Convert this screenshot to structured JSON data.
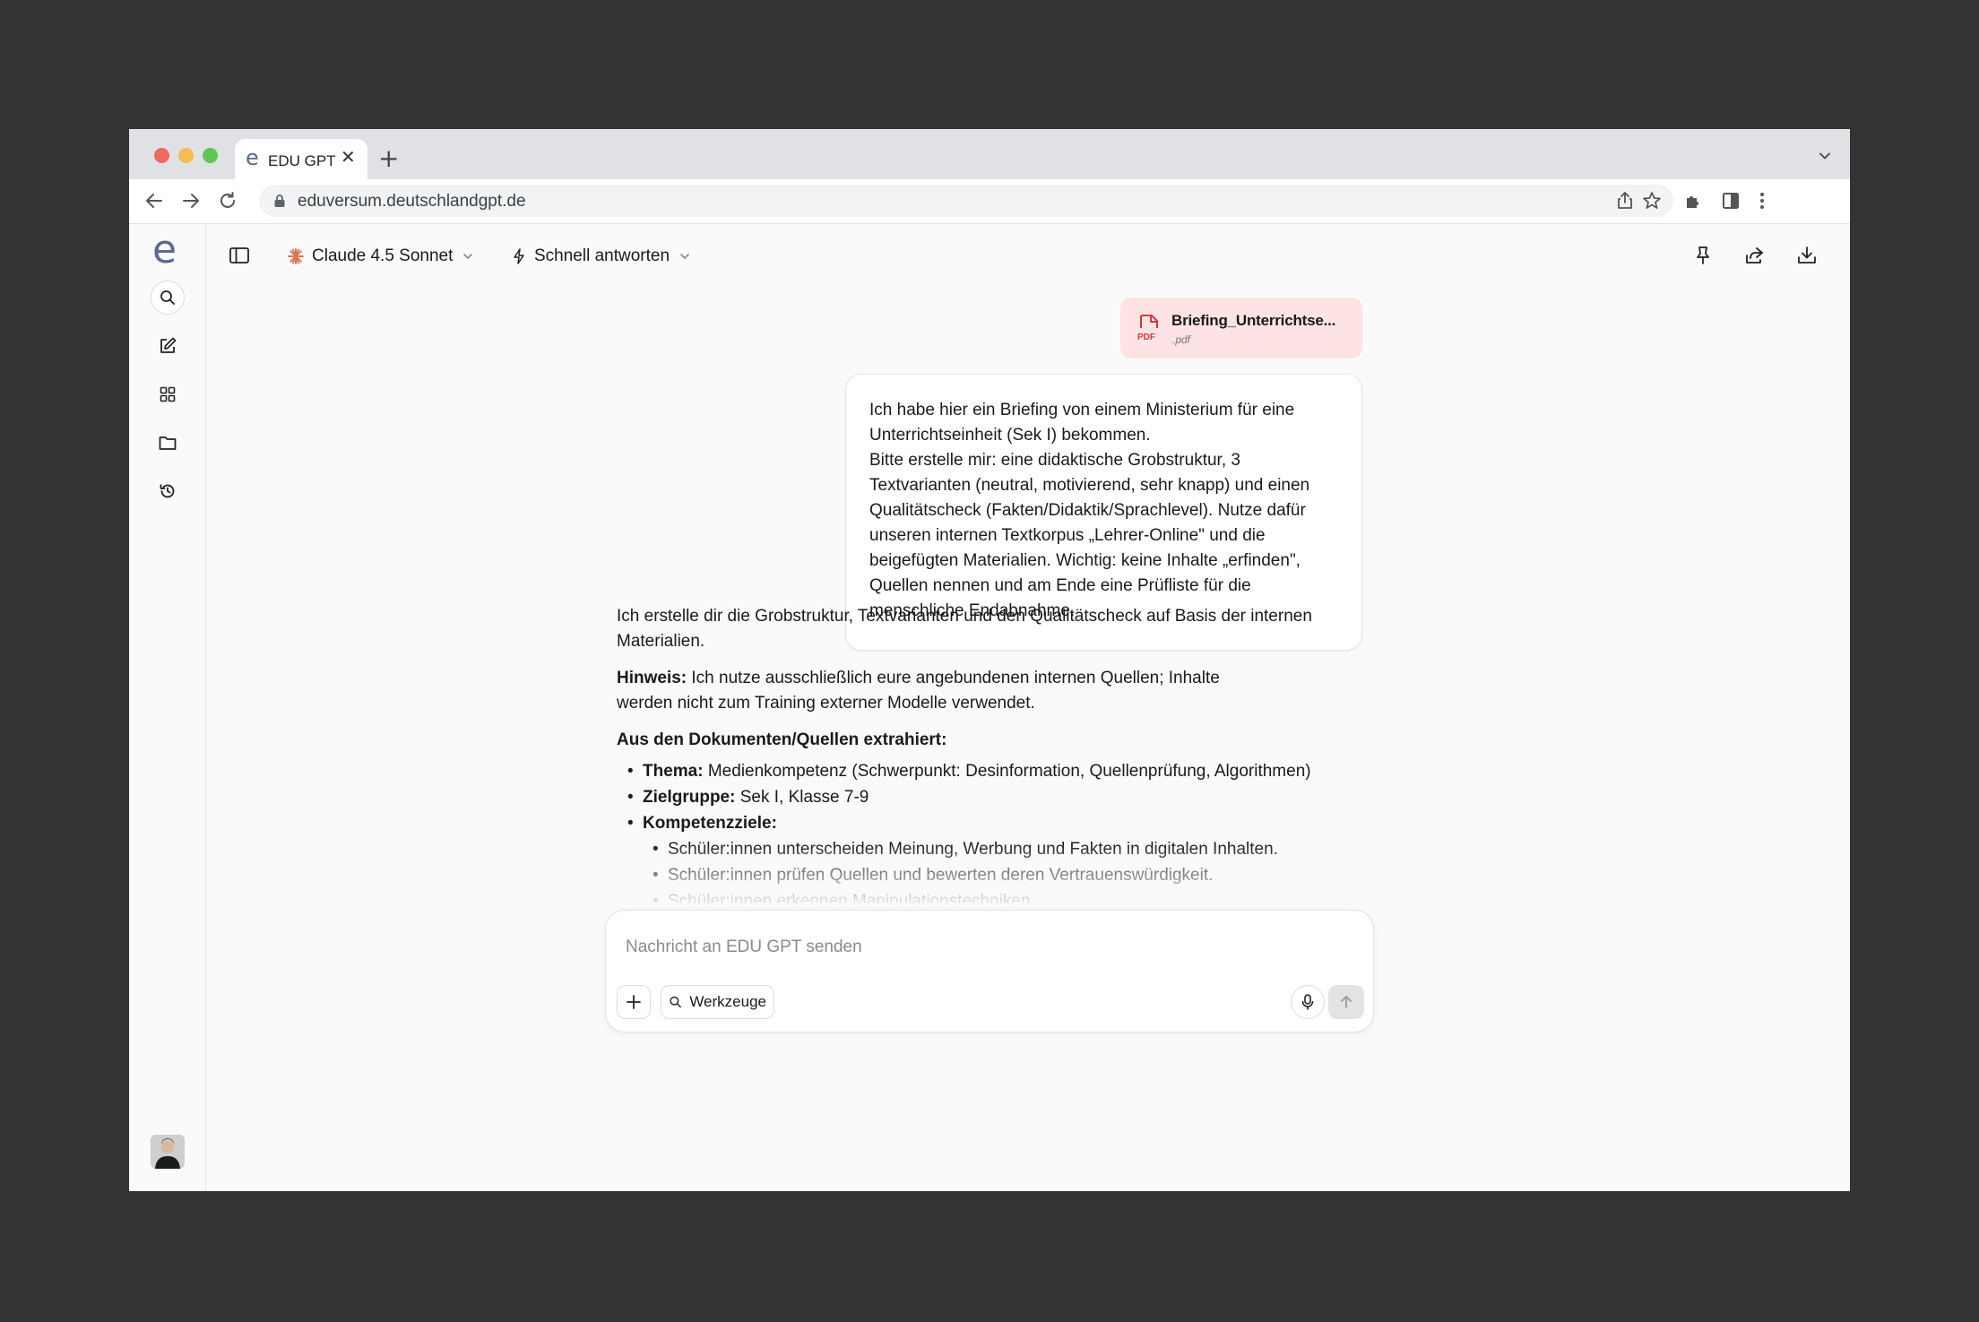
{
  "browser": {
    "tab_title": "EDU GPT",
    "tab_favicon": "e",
    "url": "eduversum.deutschlandgpt.de"
  },
  "sidebar": {
    "brand": "e",
    "items": [
      {
        "icon": "search-icon"
      },
      {
        "icon": "new-chat-icon"
      },
      {
        "icon": "apps-grid-icon"
      },
      {
        "icon": "folder-icon"
      },
      {
        "icon": "history-icon"
      }
    ]
  },
  "topbar": {
    "model": "Claude 4.5 Sonnet",
    "mode": "Schnell antworten"
  },
  "attachment": {
    "badge": "PDF",
    "name": "Briefing_Unterrichtse...",
    "ext": ".pdf"
  },
  "user_message": [
    "Ich habe hier ein Briefing von einem Ministerium für eine Unterrichtseinheit (Sek I) bekommen.",
    "Bitte erstelle mir: eine didaktische Grobstruktur, 3 Textvarianten (neutral, motivierend, sehr knapp) und einen Qualitätscheck (Fakten/Didaktik/Sprachlevel). Nutze dafür unseren internen Textkorpus „Lehrer-Online\" und die beigefügten Materialien. Wichtig: keine Inhalte „erfinden\", Quellen nennen und am Ende eine Prüfliste für die menschliche Endabnahme."
  ],
  "reply": {
    "intro": "Ich erstelle dir die Grobstruktur, Textvarianten und den Qualitätscheck auf Basis der internen Materialien.",
    "hint_label": "Hinweis:",
    "hint_line1": " Ich nutze ausschließlich eure angebundenen internen Quellen; Inhalte",
    "hint_line2": "werden nicht zum Training externer Modelle verwendet.",
    "extracted_heading": "Aus den Dokumenten/Quellen extrahiert:",
    "items": [
      {
        "label": "Thema:",
        "text": " Medienkompetenz (Schwerpunkt: Desinformation, Quellenprüfung, Algorithmen)"
      },
      {
        "label": "Zielgruppe:",
        "text": " Sek I, Klasse 7-9"
      },
      {
        "label": "Kompetenzziele:",
        "text": ""
      }
    ],
    "sub_items": [
      "Schüler:innen unterscheiden Meinung, Werbung und Fakten in digitalen Inhalten.",
      "Schüler:innen prüfen Quellen und bewerten deren Vertrauenswürdigkeit.",
      "Schüler:innen erkennen Manipulationstechniken"
    ]
  },
  "composer": {
    "placeholder": "Nachricht an EDU GPT senden",
    "tools_label": "Werkzeuge"
  }
}
